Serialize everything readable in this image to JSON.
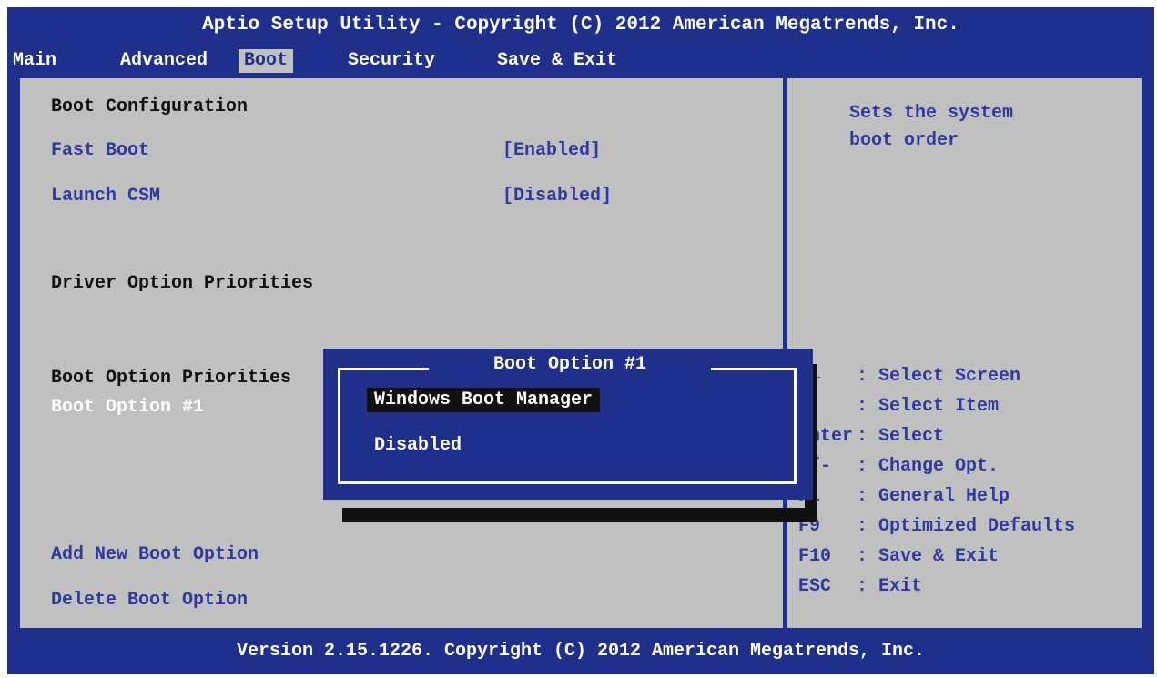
{
  "app": {
    "title": "Aptio Setup Utility - Copyright (C) 2012 American Megatrends, Inc.",
    "footer": "Version 2.15.1226. Copyright (C) 2012 American Megatrends, Inc."
  },
  "tabs": [
    {
      "label": "Main",
      "active": false
    },
    {
      "label": "Advanced",
      "active": false
    },
    {
      "label": "Boot",
      "active": true
    },
    {
      "label": "Security",
      "active": false
    },
    {
      "label": "Save & Exit",
      "active": false
    }
  ],
  "boot": {
    "boot_configuration": "Boot Configuration",
    "fast_boot": {
      "label": "Fast Boot",
      "value": "[Enabled]"
    },
    "launch_csm": {
      "label": "Launch CSM",
      "value": "[Disabled]"
    },
    "driver_option_priorities": "Driver Option Priorities",
    "boot_option_priorities": "Boot Option Priorities",
    "boot_option_1": "Boot Option #1",
    "add_new_boot_option": "Add New Boot Option",
    "delete_boot_option": "Delete Boot Option"
  },
  "help": {
    "line1": "Sets the system",
    "line2": "boot order"
  },
  "keys": [
    {
      "key": "→←",
      "desc": ": Select Screen"
    },
    {
      "key": "↑↓",
      "desc": ": Select Item"
    },
    {
      "key": "Enter",
      "desc": ": Select"
    },
    {
      "key": "+/-",
      "desc": ": Change Opt."
    },
    {
      "key": "F1",
      "desc": ": General Help"
    },
    {
      "key": "F9",
      "desc": ": Optimized Defaults"
    },
    {
      "key": "F10",
      "desc": ": Save & Exit"
    },
    {
      "key": "ESC",
      "desc": ": Exit"
    }
  ],
  "popup": {
    "title": "Boot Option #1",
    "options": [
      {
        "label": "Windows Boot Manager",
        "selected": true
      },
      {
        "label": "Disabled",
        "selected": false
      }
    ]
  },
  "colors": {
    "bios_blue": "#1f2f8c",
    "panel_gray": "#c0c0c0",
    "setting_text": "#2f3aa0",
    "highlight": "#111111"
  }
}
